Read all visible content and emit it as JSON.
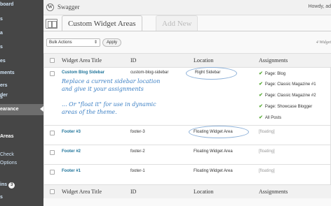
{
  "sidebar": {
    "items": [
      {
        "label": "board"
      },
      {
        "label": "s"
      },
      {
        "label": "a"
      },
      {
        "label": "s"
      },
      {
        "label": "es"
      },
      {
        "label": "ments"
      },
      {
        "label": "ers"
      },
      {
        "label": "s"
      },
      {
        "label": "der"
      },
      {
        "label": "earance"
      },
      {
        "label": "Areas"
      },
      {
        "label": "Check"
      },
      {
        "label": "Options"
      },
      {
        "label": "ins"
      },
      {
        "label": "s"
      }
    ],
    "plugins_badge": "3"
  },
  "topbar": {
    "site_title": "Swagger",
    "howdy": "Howdy, ad",
    "logo_glyph": "W"
  },
  "header": {
    "tab_active": "Custom Widget Areas",
    "tab_add": "Add New"
  },
  "toolbar": {
    "bulk_actions": "Bulk Actions",
    "apply": "Apply",
    "count": "4 Widget"
  },
  "table": {
    "columns": [
      "Widget Area Title",
      "ID",
      "Location",
      "Assignments"
    ],
    "rows": [
      {
        "title": "Custom Blog Sidebar",
        "id": "custom-blog-sidebar",
        "location": "Right Sidebar",
        "assignments": [
          "Page: Blog",
          "Page: Classic Magazine #1",
          "Page: Classic Magazine #2",
          "Page: Showcase Blogger",
          "All Posts"
        ]
      },
      {
        "title": "Footer #3",
        "id": "footer-3",
        "location": "Floating Widget Area",
        "assignment_text": "[floating]"
      },
      {
        "title": "Footer #2",
        "id": "footer-2",
        "location": "Floating Widget Area",
        "assignment_text": "[floating]"
      },
      {
        "title": "Footer #1",
        "id": "footer-1",
        "location": "Floating Widget Area",
        "assignment_text": "[floating]"
      }
    ]
  },
  "annotations": {
    "line1": "Replace a current sidebar location",
    "line2": "and give it your assignments",
    "line3": "... Or \"float it\" for use in dynamic",
    "line4": "areas of the theme."
  },
  "colors": {
    "sidebar_bg": "#464646",
    "link": "#21759b",
    "check": "#5cad3a",
    "annotation": "#3b7fc4"
  }
}
